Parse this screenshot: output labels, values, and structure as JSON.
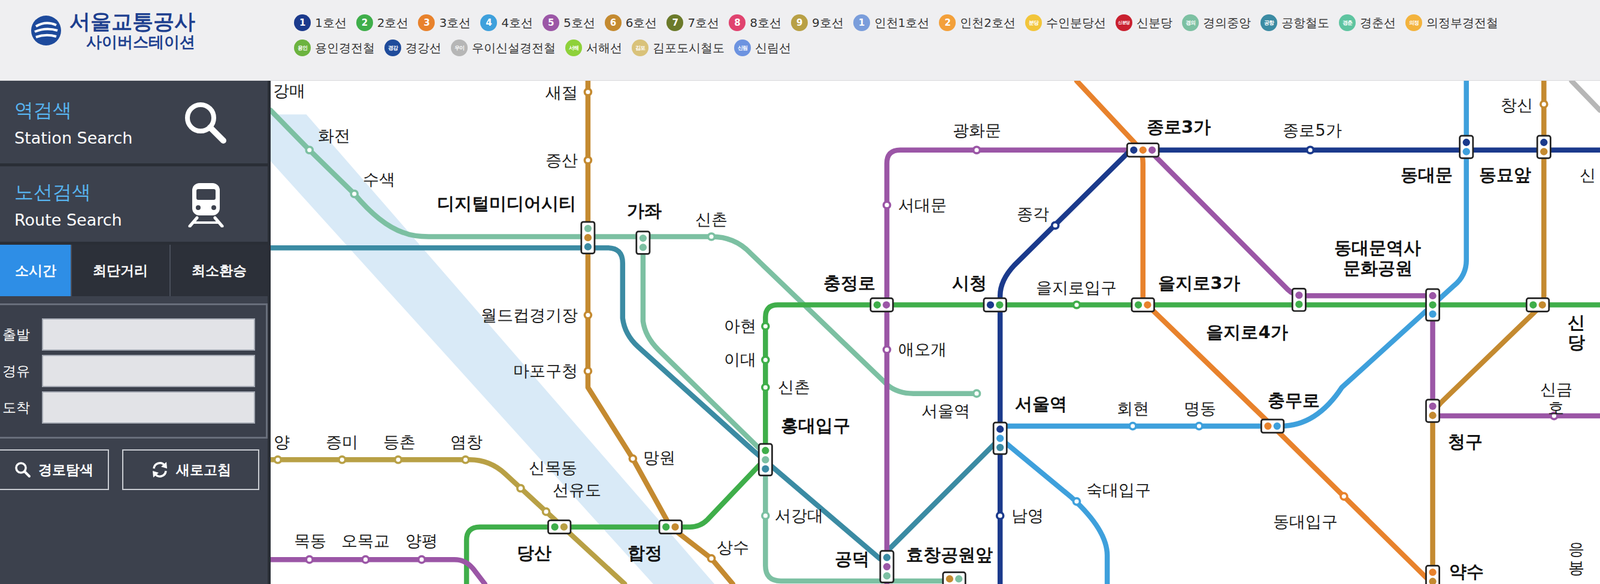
{
  "header": {
    "logo": {
      "title": "서울교통공사",
      "subtitle": "사이버스테이션"
    },
    "legend": [
      [
        {
          "badge": "1",
          "label": "1호선",
          "color": "#1b3a8c"
        },
        {
          "badge": "2",
          "label": "2호선",
          "color": "#3fae4a"
        },
        {
          "badge": "3",
          "label": "3호선",
          "color": "#e8822c"
        },
        {
          "badge": "4",
          "label": "4호선",
          "color": "#3ea0dc"
        },
        {
          "badge": "5",
          "label": "5호선",
          "color": "#9b56a6"
        },
        {
          "badge": "6",
          "label": "6호선",
          "color": "#c48a30"
        },
        {
          "badge": "7",
          "label": "7호선",
          "color": "#6b7a2a"
        },
        {
          "badge": "8",
          "label": "8호선",
          "color": "#e0436f"
        },
        {
          "badge": "9",
          "label": "9호선",
          "color": "#b8a045"
        },
        {
          "badge": "1",
          "label": "인천1호선",
          "color": "#7a9ddb"
        },
        {
          "badge": "2",
          "label": "인천2호선",
          "color": "#f3a03a"
        },
        {
          "badge": "분당",
          "label": "수인분당선",
          "color": "#f2c53a"
        },
        {
          "badge": "신분당",
          "label": "신분당",
          "color": "#c9202f"
        },
        {
          "badge": "경의",
          "label": "경의중앙",
          "color": "#7cc0a2"
        },
        {
          "badge": "공항",
          "label": "공항철도",
          "color": "#3b8ba3"
        },
        {
          "badge": "경춘",
          "label": "경춘선",
          "color": "#5ec4a0"
        },
        {
          "badge": "의정",
          "label": "의정부경전철",
          "color": "#f3b33d"
        }
      ],
      [
        {
          "badge": "용인",
          "label": "용인경전철",
          "color": "#6cb33f"
        },
        {
          "badge": "경강",
          "label": "경강선",
          "color": "#1f4b9b"
        },
        {
          "badge": "우이",
          "label": "우이신설경전철",
          "color": "#b6b6b6"
        },
        {
          "badge": "서해",
          "label": "서해선",
          "color": "#8ed13a"
        },
        {
          "badge": "김포",
          "label": "김포도시철도",
          "color": "#d9c27a"
        },
        {
          "badge": "신림",
          "label": "신림선",
          "color": "#6d93e0"
        }
      ]
    ]
  },
  "sidebar": {
    "nav": [
      {
        "title": "역검색",
        "subtitle": "Station Search"
      },
      {
        "title": "노선검색",
        "subtitle": "Route Search"
      }
    ],
    "tabs": [
      {
        "label": "소시간",
        "selected": true
      },
      {
        "label": "최단거리",
        "selected": false
      },
      {
        "label": "최소환승",
        "selected": false
      }
    ],
    "fields": [
      {
        "label": "출발",
        "value": ""
      },
      {
        "label": "경유",
        "value": ""
      },
      {
        "label": "도착",
        "value": ""
      }
    ],
    "buttons": [
      {
        "label": "경로탐색"
      },
      {
        "label": "새로고침"
      }
    ]
  },
  "map": {
    "stations": [
      {
        "name": "강매",
        "kind": "label"
      },
      {
        "name": "화전",
        "kind": "station"
      },
      {
        "name": "수색",
        "kind": "station"
      },
      {
        "name": "새절",
        "kind": "station"
      },
      {
        "name": "증산",
        "kind": "station"
      },
      {
        "name": "디지털미디어시티",
        "kind": "transfer"
      },
      {
        "name": "가좌",
        "kind": "transfer"
      },
      {
        "name": "신촌",
        "kind": "station"
      },
      {
        "name": "광화문",
        "kind": "station"
      },
      {
        "name": "종로3가",
        "kind": "transfer"
      },
      {
        "name": "종로5가",
        "kind": "station"
      },
      {
        "name": "동대문",
        "kind": "transfer"
      },
      {
        "name": "동묘앞",
        "kind": "transfer"
      },
      {
        "name": "창신",
        "kind": "station"
      },
      {
        "name": "신",
        "kind": "label"
      },
      {
        "name": "서대문",
        "kind": "station"
      },
      {
        "name": "종각",
        "kind": "station"
      },
      {
        "name": "충정로",
        "kind": "transfer"
      },
      {
        "name": "시청",
        "kind": "transfer"
      },
      {
        "name": "을지로입구",
        "kind": "station"
      },
      {
        "name": "을지로3가",
        "kind": "transfer"
      },
      {
        "name": "을지로4가",
        "kind": "transfer"
      },
      {
        "name": "동대문역사\n문화공원",
        "kind": "transfer"
      },
      {
        "name": "신당",
        "kind": "transfer"
      },
      {
        "name": "아현",
        "kind": "station"
      },
      {
        "name": "이대",
        "kind": "station"
      },
      {
        "name": "신촌",
        "kind": "station"
      },
      {
        "name": "월드컵경기장",
        "kind": "station"
      },
      {
        "name": "마포구청",
        "kind": "station"
      },
      {
        "name": "애오개",
        "kind": "station"
      },
      {
        "name": "서울역",
        "kind": "station"
      },
      {
        "name": "서울역",
        "kind": "transfer"
      },
      {
        "name": "회현",
        "kind": "station"
      },
      {
        "name": "명동",
        "kind": "station"
      },
      {
        "name": "충무로",
        "kind": "transfer"
      },
      {
        "name": "청구",
        "kind": "transfer"
      },
      {
        "name": "신금호",
        "kind": "station"
      },
      {
        "name": "홍대입구",
        "kind": "transfer"
      },
      {
        "name": "양",
        "kind": "station"
      },
      {
        "name": "증미",
        "kind": "station"
      },
      {
        "name": "등촌",
        "kind": "station"
      },
      {
        "name": "염창",
        "kind": "station"
      },
      {
        "name": "신목동",
        "kind": "station"
      },
      {
        "name": "선유도",
        "kind": "station"
      },
      {
        "name": "망원",
        "kind": "station"
      },
      {
        "name": "당산",
        "kind": "transfer"
      },
      {
        "name": "합정",
        "kind": "transfer"
      },
      {
        "name": "상수",
        "kind": "station"
      },
      {
        "name": "서강대",
        "kind": "station"
      },
      {
        "name": "공덕",
        "kind": "transfer"
      },
      {
        "name": "효창공원앞",
        "kind": "transfer"
      },
      {
        "name": "남영",
        "kind": "station"
      },
      {
        "name": "숙대입구",
        "kind": "station"
      },
      {
        "name": "동대입구",
        "kind": "station"
      },
      {
        "name": "약수",
        "kind": "transfer"
      },
      {
        "name": "목동",
        "kind": "station"
      },
      {
        "name": "오목교",
        "kind": "station"
      },
      {
        "name": "양평",
        "kind": "station"
      },
      {
        "name": "응봉",
        "kind": "label"
      }
    ]
  }
}
